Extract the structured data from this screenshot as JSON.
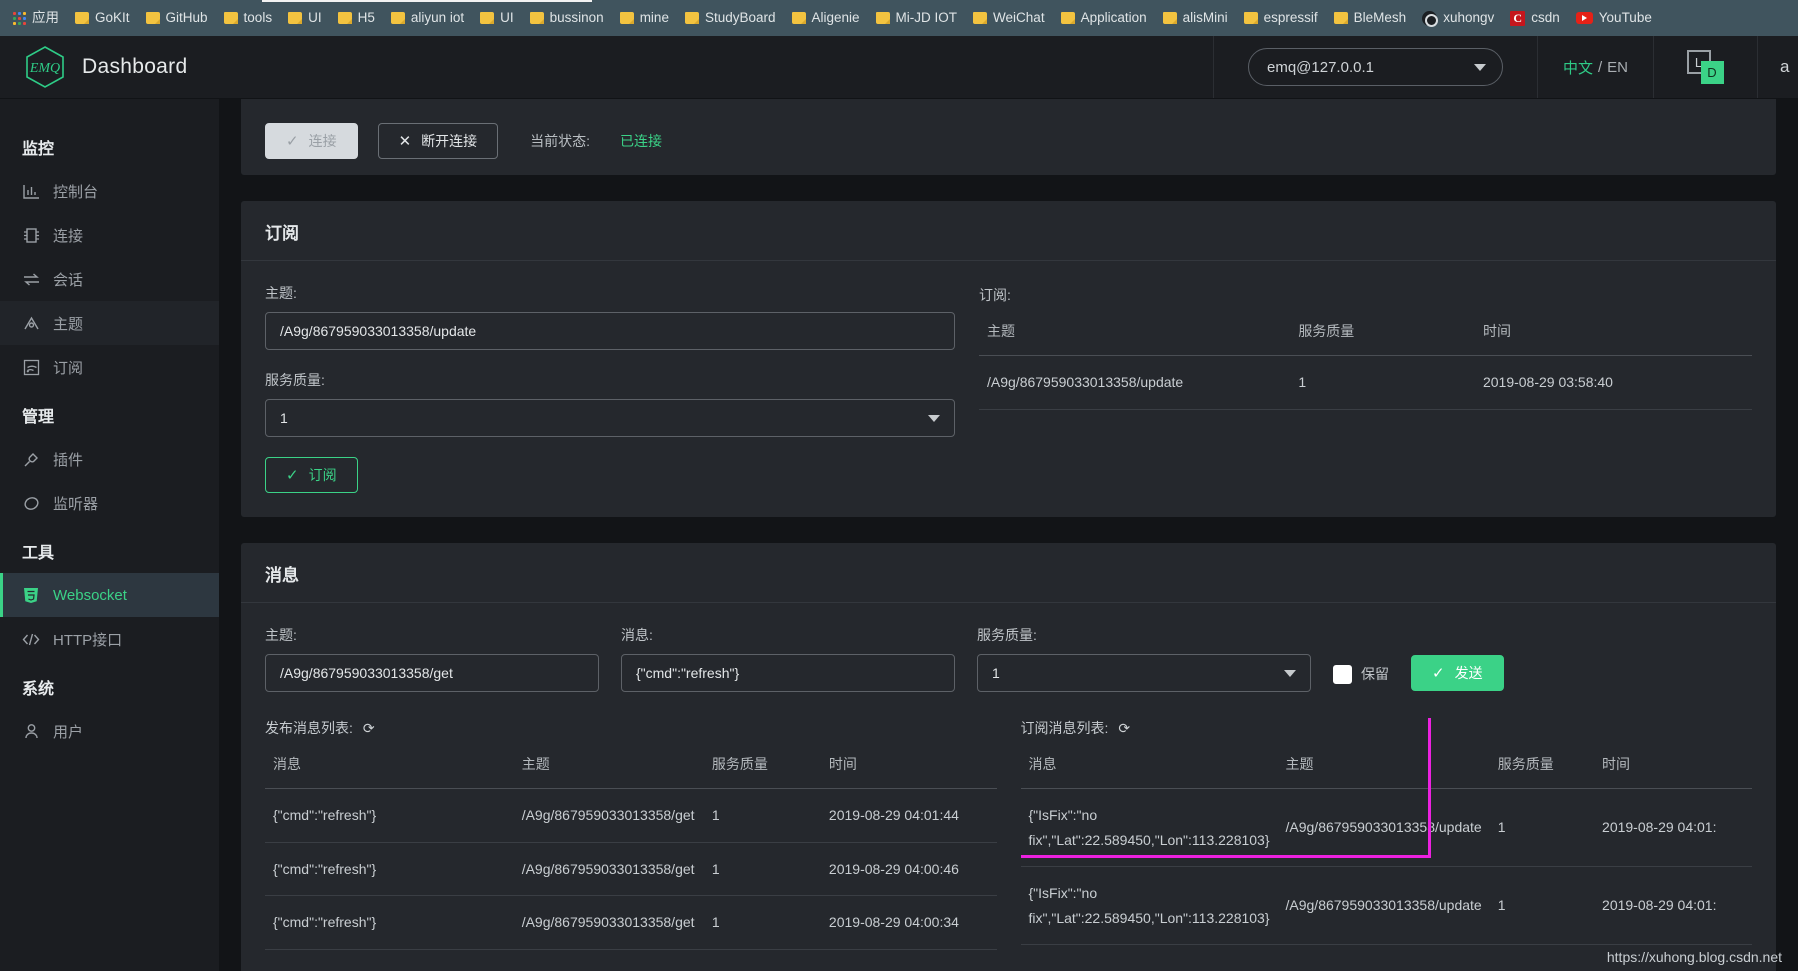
{
  "browser": {
    "bookmarks": [
      {
        "label": "应用",
        "icon": "apps-grid-icon"
      },
      {
        "label": "GoKIt",
        "icon": "folder-icon"
      },
      {
        "label": "GitHub",
        "icon": "folder-icon"
      },
      {
        "label": "tools",
        "icon": "folder-icon"
      },
      {
        "label": "UI",
        "icon": "folder-icon"
      },
      {
        "label": "H5",
        "icon": "folder-icon"
      },
      {
        "label": "aliyun iot",
        "icon": "folder-icon"
      },
      {
        "label": "UI",
        "icon": "folder-icon"
      },
      {
        "label": "bussinon",
        "icon": "folder-icon"
      },
      {
        "label": "mine",
        "icon": "folder-icon"
      },
      {
        "label": "StudyBoard",
        "icon": "folder-icon"
      },
      {
        "label": "Aligenie",
        "icon": "folder-icon"
      },
      {
        "label": "Mi-JD IOT",
        "icon": "folder-icon"
      },
      {
        "label": "WeiChat",
        "icon": "folder-icon"
      },
      {
        "label": "Application",
        "icon": "folder-icon"
      },
      {
        "label": "alisMini",
        "icon": "folder-icon"
      },
      {
        "label": "espressif",
        "icon": "folder-icon"
      },
      {
        "label": "BleMesh",
        "icon": "folder-icon"
      },
      {
        "label": "xuhongv",
        "icon": "github-icon"
      },
      {
        "label": "csdn",
        "icon": "csdn-icon"
      },
      {
        "label": "YouTube",
        "icon": "youtube-icon"
      }
    ]
  },
  "header": {
    "logo_text": "EMQ",
    "title": "Dashboard",
    "node_value": "emq@127.0.0.1",
    "lang_cn": "中文",
    "lang_sep": "/",
    "lang_en": "EN",
    "badge_l": "L",
    "badge_d": "D",
    "user": "a"
  },
  "sidebar": {
    "groups": [
      {
        "title": "监控",
        "items": [
          {
            "label": "控制台",
            "icon": "chart-bar-icon",
            "state": "normal"
          },
          {
            "label": "连接",
            "icon": "chip-icon",
            "state": "normal"
          },
          {
            "label": "会话",
            "icon": "exchange-arrows-icon",
            "state": "normal"
          },
          {
            "label": "主题",
            "icon": "topic-icon",
            "state": "hover"
          },
          {
            "label": "订阅",
            "icon": "rss-icon",
            "state": "normal"
          }
        ]
      },
      {
        "title": "管理",
        "items": [
          {
            "label": "插件",
            "icon": "plug-icon",
            "state": "normal"
          },
          {
            "label": "监听器",
            "icon": "listener-icon",
            "state": "normal"
          }
        ]
      },
      {
        "title": "工具",
        "items": [
          {
            "label": "Websocket",
            "icon": "html5-icon",
            "state": "active"
          },
          {
            "label": "HTTP接口",
            "icon": "code-icon",
            "state": "normal"
          }
        ]
      },
      {
        "title": "系统",
        "items": [
          {
            "label": "用户",
            "icon": "user-icon",
            "state": "normal"
          }
        ]
      }
    ]
  },
  "connection": {
    "connect_label": "连接",
    "disconnect_label": "断开连接",
    "status_label": "当前状态:",
    "status_value": "已连接"
  },
  "subscribe_panel": {
    "title": "订阅",
    "topic_label": "主题:",
    "topic_value": "/A9g/867959033013358/update",
    "qos_label": "服务质量:",
    "qos_value": "1",
    "submit_label": "订阅",
    "list_label": "订阅:",
    "columns": [
      "主题",
      "服务质量",
      "时间"
    ],
    "rows": [
      {
        "topic": "/A9g/867959033013358/update",
        "qos": "1",
        "time": "2019-08-29 03:58:40"
      }
    ]
  },
  "message_panel": {
    "title": "消息",
    "topic_label": "主题:",
    "topic_value": "/A9g/867959033013358/get",
    "message_label": "消息:",
    "message_value": "{\"cmd\":\"refresh\"}",
    "qos_label": "服务质量:",
    "qos_value": "1",
    "retain_label": "保留",
    "send_label": "发送"
  },
  "published_list": {
    "title": "发布消息列表:",
    "refresh_icon": "refresh-icon",
    "columns": [
      "消息",
      "主题",
      "服务质量",
      "时间"
    ],
    "rows": [
      {
        "message": "{\"cmd\":\"refresh\"}",
        "topic": "/A9g/867959033013358/get",
        "qos": "1",
        "time": "2019-08-29 04:01:44"
      },
      {
        "message": "{\"cmd\":\"refresh\"}",
        "topic": "/A9g/867959033013358/get",
        "qos": "1",
        "time": "2019-08-29 04:00:46"
      },
      {
        "message": "{\"cmd\":\"refresh\"}",
        "topic": "/A9g/867959033013358/get",
        "qos": "1",
        "time": "2019-08-29 04:00:34"
      }
    ]
  },
  "subscribed_list": {
    "title": "订阅消息列表:",
    "refresh_icon": "refresh-icon",
    "columns": [
      "消息",
      "主题",
      "服务质量",
      "时间"
    ],
    "rows": [
      {
        "message": "{\"IsFix\":\"no fix\",\"Lat\":22.589450,\"Lon\":113.228103}",
        "topic": "/A9g/867959033013358/update",
        "qos": "1",
        "time": "2019-08-29 04:01:"
      },
      {
        "message": "{\"IsFix\":\"no fix\",\"Lat\":22.589450,\"Lon\":113.228103}",
        "topic": "/A9g/867959033013358/update",
        "qos": "1",
        "time": "2019-08-29 04:01:"
      }
    ],
    "highlight_color": "#ec21e0"
  },
  "watermark": "https://xuhong.blog.csdn.net"
}
